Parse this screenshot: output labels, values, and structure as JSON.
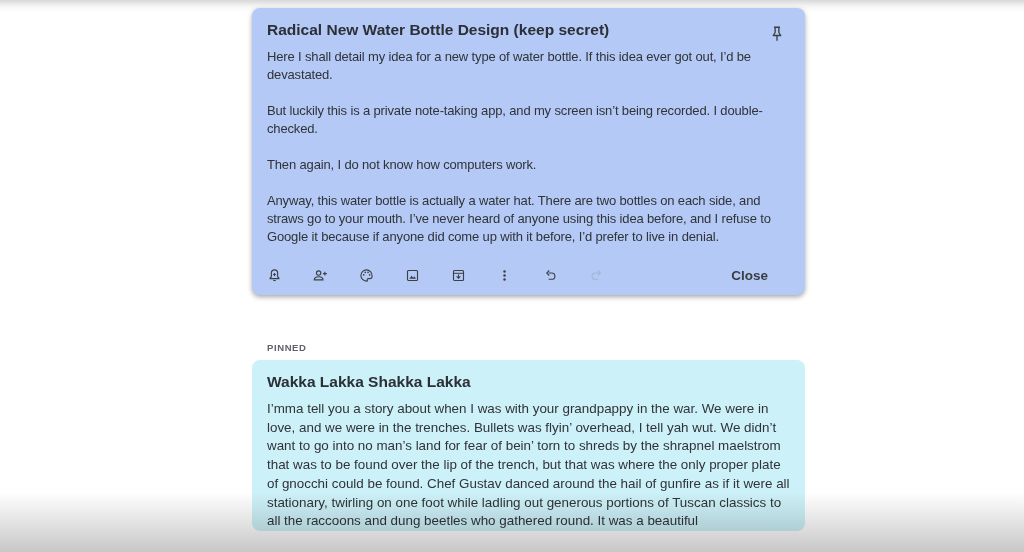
{
  "open_note": {
    "title": "Radical New Water Bottle Design (keep secret)",
    "paragraphs": [
      "Here I shall detail my idea for a new type of water bottle. If this idea ever got out, I’d be devastated.",
      "But luckily this is a private note-taking app, and my screen isn’t being recorded. I double-checked.",
      "Then again, I do not know how computers work.",
      "Anyway, this water bottle is actually a water hat. There are two bottles on each side, and straws go to your mouth. I’ve never heard of anyone using this idea before, and I refuse to Google it because if anyone did come up with it before, I’d prefer to live in denial."
    ],
    "toolbar": [
      {
        "kind": "reminder",
        "disabled": false
      },
      {
        "kind": "collaborator",
        "disabled": false
      },
      {
        "kind": "palette",
        "disabled": false
      },
      {
        "kind": "image",
        "disabled": false
      },
      {
        "kind": "archive",
        "disabled": false
      },
      {
        "kind": "more",
        "disabled": false
      },
      {
        "kind": "undo",
        "disabled": false
      },
      {
        "kind": "redo",
        "disabled": true
      }
    ],
    "close_label": "Close"
  },
  "section_label": "PINNED",
  "pinned_note": {
    "title": "Wakka Lakka Shakka Lakka",
    "body": "I’mma tell you a story about when I was with your grandpappy in the war. We were in love, and we were in the trenches. Bullets was flyin’ overhead, I tell yah wut. We didn’t want to go into no man’s land for fear of bein’ torn to shreds by the shrapnel maelstrom that was to be found over the lip of the trench, but that was where the only proper plate of gnocchi could be found. Chef Gustav danced around the hail of gunfire as if it were all stationary, twirling on one foot while ladling out generous portions of Tuscan classics to all the raccoons and dung beetles who gathered round. It was a beautiful"
  }
}
